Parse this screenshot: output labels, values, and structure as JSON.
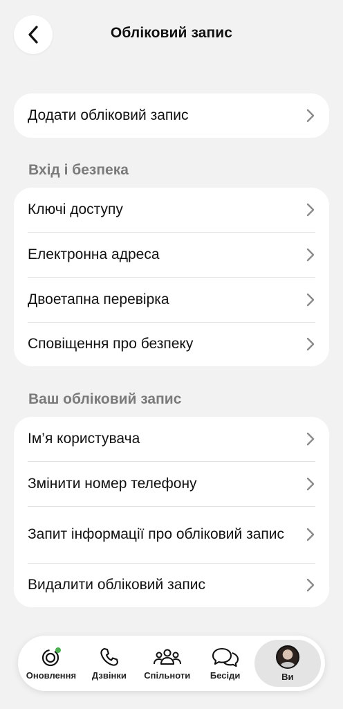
{
  "header": {
    "title": "Обліковий запис",
    "back_icon": "chevron-left-icon"
  },
  "top_card": {
    "items": [
      {
        "label": "Додати обліковий запис"
      }
    ]
  },
  "security_section": {
    "title": "Вхід і безпека",
    "items": [
      {
        "label": "Ключі доступу"
      },
      {
        "label": "Електронна адреса"
      },
      {
        "label": "Двоетапна перевірка"
      },
      {
        "label": "Сповіщення про безпеку"
      }
    ]
  },
  "account_section": {
    "title": "Ваш обліковий запис",
    "items": [
      {
        "label": "Ім’я користувача"
      },
      {
        "label": "Змінити номер телефону"
      },
      {
        "label": "Запит інформації про обліковий запис"
      },
      {
        "label": "Видалити обліковий запис"
      }
    ]
  },
  "tabbar": {
    "tabs": [
      {
        "label": "Оновлення",
        "icon": "updates-icon"
      },
      {
        "label": "Дзвінки",
        "icon": "phone-icon"
      },
      {
        "label": "Спільноти",
        "icon": "communities-icon"
      },
      {
        "label": "Бесіди",
        "icon": "chats-icon"
      },
      {
        "label": "Ви",
        "icon": "avatar",
        "active": true
      }
    ]
  },
  "colors": {
    "background": "#f2f2f2",
    "card": "#ffffff",
    "section_title": "#7a7a7a",
    "status_dot": "#4caf50"
  }
}
